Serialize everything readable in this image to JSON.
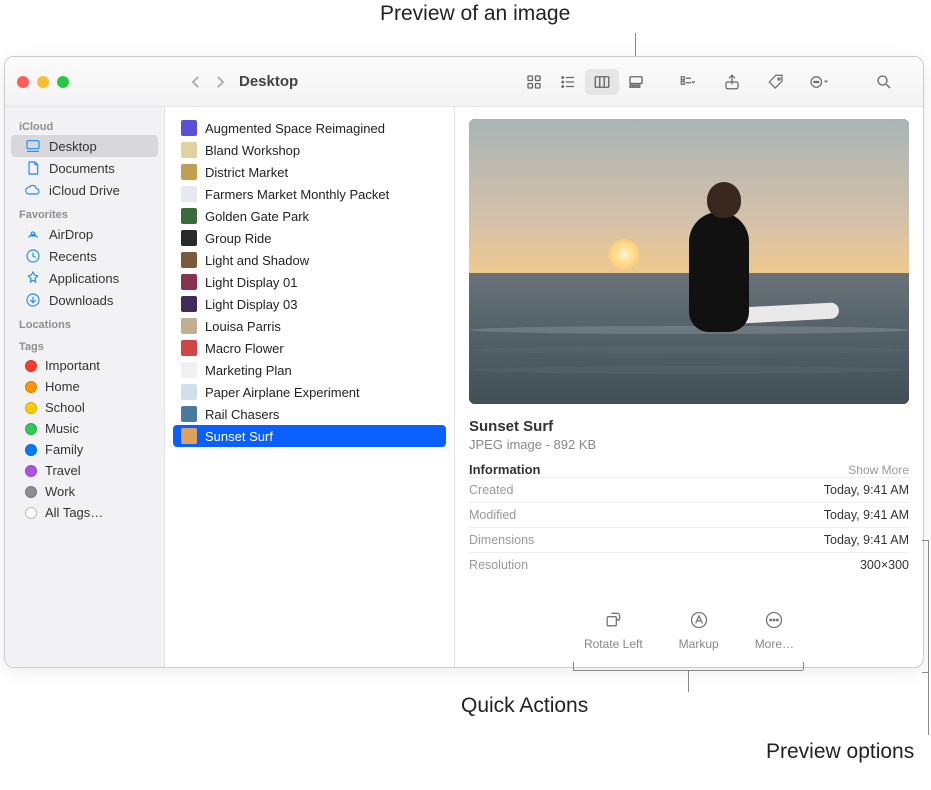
{
  "callouts": {
    "preview_image": "Preview of an image",
    "quick_actions": "Quick Actions",
    "preview_options": "Preview options"
  },
  "window": {
    "title": "Desktop"
  },
  "sidebar": {
    "sections": [
      {
        "heading": "iCloud",
        "items": [
          {
            "label": "Desktop",
            "icon": "desktop",
            "selected": true
          },
          {
            "label": "Documents",
            "icon": "doc",
            "selected": false
          },
          {
            "label": "iCloud Drive",
            "icon": "cloud",
            "selected": false
          }
        ]
      },
      {
        "heading": "Favorites",
        "items": [
          {
            "label": "AirDrop",
            "icon": "airdrop"
          },
          {
            "label": "Recents",
            "icon": "clock"
          },
          {
            "label": "Applications",
            "icon": "apps"
          },
          {
            "label": "Downloads",
            "icon": "download"
          }
        ]
      },
      {
        "heading": "Locations",
        "items": []
      },
      {
        "heading": "Tags",
        "items": [
          {
            "label": "Important",
            "color": "#ff3b30"
          },
          {
            "label": "Home",
            "color": "#ff9500"
          },
          {
            "label": "School",
            "color": "#ffcc00"
          },
          {
            "label": "Music",
            "color": "#34c759"
          },
          {
            "label": "Family",
            "color": "#007aff"
          },
          {
            "label": "Travel",
            "color": "#af52de"
          },
          {
            "label": "Work",
            "color": "#8e8e93"
          },
          {
            "label": "All Tags…",
            "color": "#ffffff",
            "hollow": true
          }
        ]
      }
    ]
  },
  "files": [
    {
      "name": "Augmented Space Reimagined",
      "bg": "#5b4fd6"
    },
    {
      "name": "Bland Workshop",
      "bg": "#e0d2a0"
    },
    {
      "name": "District Market",
      "bg": "#c0a050"
    },
    {
      "name": "Farmers Market Monthly Packet",
      "bg": "#e8e8f0"
    },
    {
      "name": "Golden Gate Park",
      "bg": "#3a6a3a"
    },
    {
      "name": "Group Ride",
      "bg": "#2a2a2a"
    },
    {
      "name": "Light and Shadow",
      "bg": "#7a5a3a"
    },
    {
      "name": "Light Display 01",
      "bg": "#8a3050"
    },
    {
      "name": "Light Display 03",
      "bg": "#402a5a"
    },
    {
      "name": "Louisa Parris",
      "bg": "#c0b090"
    },
    {
      "name": "Macro Flower",
      "bg": "#d04545"
    },
    {
      "name": "Marketing Plan",
      "bg": "#f0f0f0"
    },
    {
      "name": "Paper Airplane Experiment",
      "bg": "#d0e0e8"
    },
    {
      "name": "Rail Chasers",
      "bg": "#4a7aa0"
    },
    {
      "name": "Sunset Surf",
      "bg": "#e0a060",
      "selected": true
    }
  ],
  "preview": {
    "title": "Sunset Surf",
    "subtitle": "JPEG image - 892 KB",
    "info_heading": "Information",
    "show_more": "Show More",
    "rows": [
      {
        "k": "Created",
        "v": "Today, 9:41 AM"
      },
      {
        "k": "Modified",
        "v": "Today, 9:41 AM"
      },
      {
        "k": "Dimensions",
        "v": "Today, 9:41 AM"
      },
      {
        "k": "Resolution",
        "v": "300×300"
      }
    ],
    "actions": [
      {
        "label": "Rotate Left",
        "icon": "rotate"
      },
      {
        "label": "Markup",
        "icon": "markup"
      },
      {
        "label": "More…",
        "icon": "more"
      }
    ]
  }
}
